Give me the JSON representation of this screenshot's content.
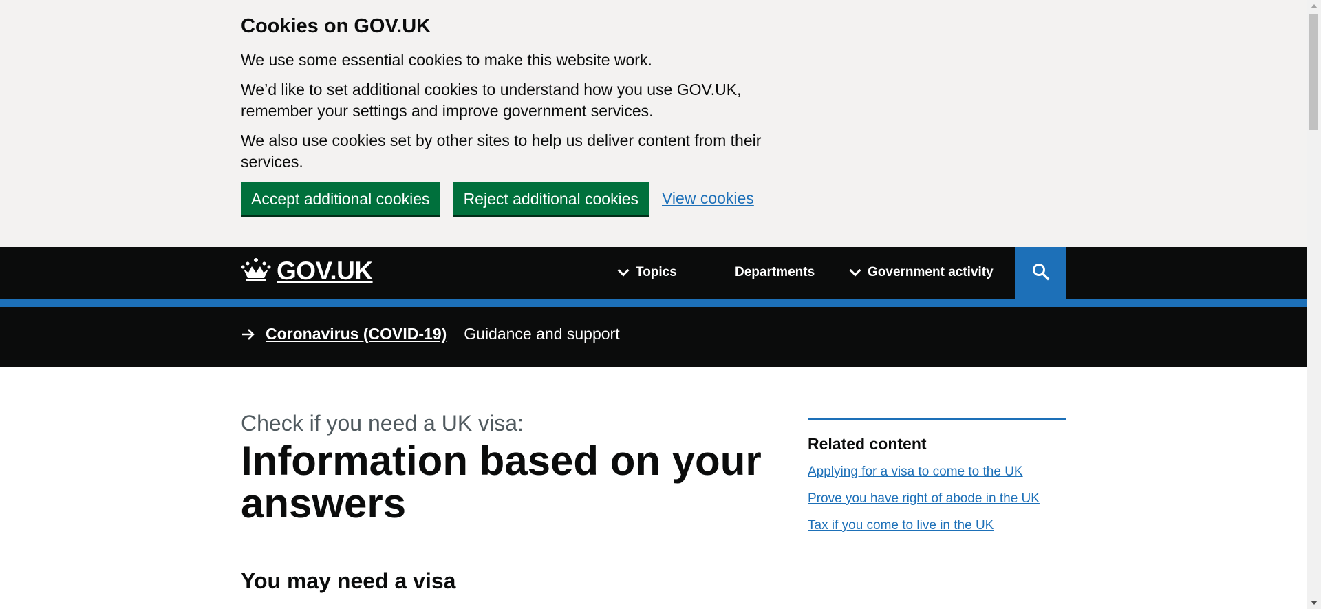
{
  "cookie_banner": {
    "title": "Cookies on GOV.UK",
    "paragraphs": [
      "We use some essential cookies to make this website work.",
      "We’d like to set additional cookies to understand how you use GOV.UK, remember your settings and improve government services.",
      "We also use cookies set by other sites to help us deliver content from their services."
    ],
    "accept_label": "Accept additional cookies",
    "reject_label": "Reject additional cookies",
    "view_label": "View cookies"
  },
  "header": {
    "logo_text": "GOV.UK",
    "logo_icon": "crown-icon",
    "nav": {
      "topics": "Topics",
      "departments": "Departments",
      "government_activity": "Government activity"
    },
    "search_icon": "search-icon"
  },
  "covid_banner": {
    "link": "Coronavirus (COVID-19)",
    "text": "Guidance and support"
  },
  "main": {
    "caption": "Check if you need a UK visa:",
    "title": "Information based on your answers",
    "subheading": "You may need a visa"
  },
  "related": {
    "title": "Related content",
    "links": [
      "Applying for a visa to come to the UK",
      "Prove you have right of abode in the UK",
      "Tax if you come to live in the UK"
    ]
  },
  "colors": {
    "brand_blue": "#1d70b8",
    "button_green": "#00703c",
    "header_black": "#0b0c0c",
    "banner_grey": "#f3f2f1"
  }
}
